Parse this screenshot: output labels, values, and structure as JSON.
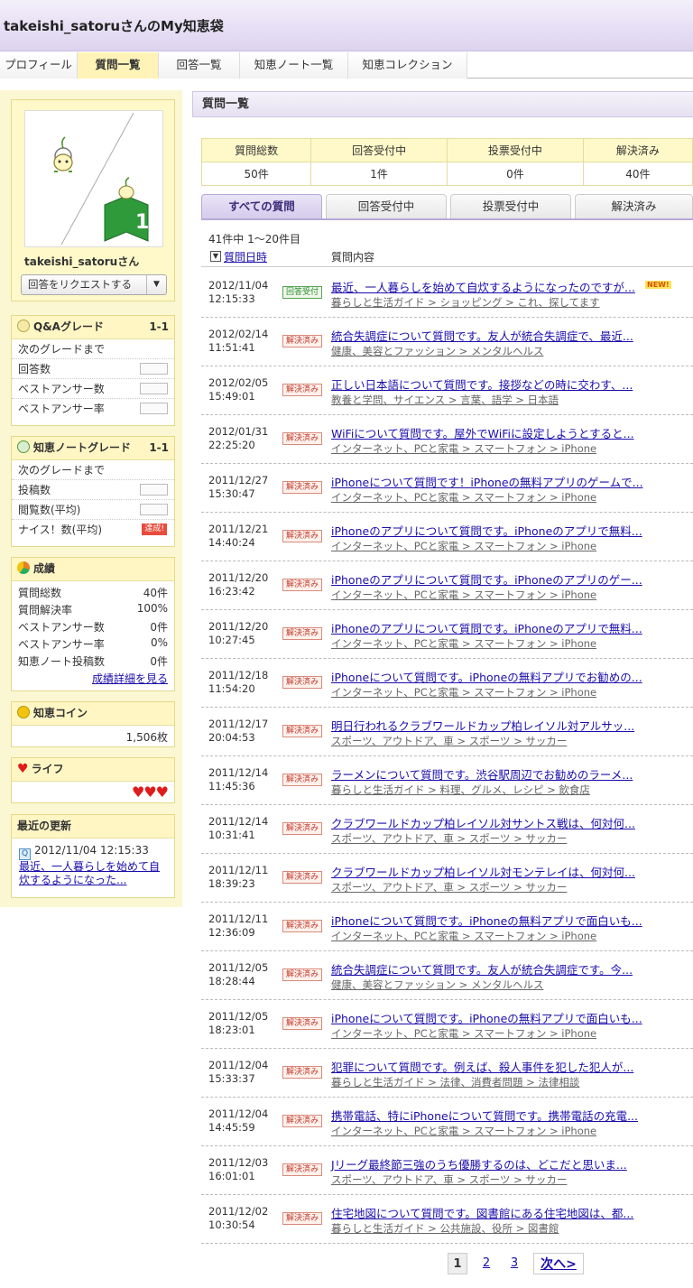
{
  "page_title": "takeishi_satoruさんのMy知恵袋",
  "nav_tabs": [
    {
      "label": "プロフィール"
    },
    {
      "label": "質問一覧"
    },
    {
      "label": "回答一覧"
    },
    {
      "label": "知恵ノート一覧"
    },
    {
      "label": "知恵コレクション"
    }
  ],
  "profile": {
    "username": "takeishi_satoruさん",
    "request_button": "回答をリクエストする",
    "avatar_badge": "1"
  },
  "qa_grade": {
    "title": "Q&Aグレード",
    "grade": "1-1",
    "rows": [
      "次のグレードまで",
      "回答数",
      "ベストアンサー数",
      "ベストアンサー率"
    ]
  },
  "note_grade": {
    "title": "知恵ノートグレード",
    "grade": "1-1",
    "rows": [
      "次のグレードまで",
      "投稿数",
      "閲覧数(平均)",
      "ナイス！数(平均)"
    ],
    "badge": "達成!"
  },
  "results": {
    "title": "成績",
    "rows": [
      {
        "label": "質問総数",
        "value": "40件"
      },
      {
        "label": "質問解決率",
        "value": "100%"
      },
      {
        "label": "ベストアンサー数",
        "value": "0件"
      },
      {
        "label": "ベストアンサー率",
        "value": "0%"
      },
      {
        "label": "知恵ノート投稿数",
        "value": "0件"
      }
    ],
    "detail_link": "成績詳細を見る"
  },
  "coins": {
    "title": "知恵コイン",
    "value": "1,506枚"
  },
  "life": {
    "title": "ライフ",
    "hearts": "♥♥♥"
  },
  "recent": {
    "title": "最近の更新",
    "date": "2012/11/04 12:15:33",
    "link": "最近、一人暮らしを始めて自炊するようになった..."
  },
  "main": {
    "heading": "質問一覧"
  },
  "stats": {
    "headers": [
      "質問総数",
      "回答受付中",
      "投票受付中",
      "解決済み"
    ],
    "values": [
      "50件",
      "1件",
      "0件",
      "40件"
    ]
  },
  "filter_tabs": [
    "すべての質問",
    "回答受付中",
    "投票受付中",
    "解決済み"
  ],
  "count_text": "41件中 1〜20件目",
  "col_headers": {
    "sort_icon": "▼",
    "date": "質問日時",
    "content": "質問内容"
  },
  "questions": [
    {
      "date": "2012/11/04",
      "time": "12:15:33",
      "status": "回答受付",
      "title": "最近、一人暮らしを始めて自炊するようになったのですが...",
      "cat": "暮らしと生活ガイド > ショッピング > これ、探してます",
      "new": "NEW!"
    },
    {
      "date": "2012/02/14",
      "time": "11:51:41",
      "status": "解決済み",
      "title": "統合失調症について質問です。友人が統合失調症で、最近...",
      "cat": "健康、美容とファッション > メンタルヘルス"
    },
    {
      "date": "2012/02/05",
      "time": "15:49:01",
      "status": "解決済み",
      "title": "正しい日本語について質問です。接拶などの時に交わす、...",
      "cat": "教養と学問、サイエンス > 言葉、語学 > 日本語"
    },
    {
      "date": "2012/01/31",
      "time": "22:25:20",
      "status": "解決済み",
      "title": "WiFiについて質問です。屋外でWiFiに設定しようとすると...",
      "cat": "インターネット、PCと家電 > スマートフォン > iPhone"
    },
    {
      "date": "2011/12/27",
      "time": "15:30:47",
      "status": "解決済み",
      "title": "iPhoneについて質問です！iPhoneの無料アプリのゲームで...",
      "cat": "インターネット、PCと家電 > スマートフォン > iPhone"
    },
    {
      "date": "2011/12/21",
      "time": "14:40:24",
      "status": "解決済み",
      "title": "iPhoneのアプリについて質問です。iPhoneのアプリで無料...",
      "cat": "インターネット、PCと家電 > スマートフォン > iPhone"
    },
    {
      "date": "2011/12/20",
      "time": "16:23:42",
      "status": "解決済み",
      "title": "iPhoneのアプリについて質問です。iPhoneのアプリのゲー...",
      "cat": "インターネット、PCと家電 > スマートフォン > iPhone"
    },
    {
      "date": "2011/12/20",
      "time": "10:27:45",
      "status": "解決済み",
      "title": "iPhoneのアプリについて質問です。iPhoneのアプリで無料...",
      "cat": "インターネット、PCと家電 > スマートフォン > iPhone"
    },
    {
      "date": "2011/12/18",
      "time": "11:54:20",
      "status": "解決済み",
      "title": "iPhoneについて質問です。iPhoneの無料アプリでお勧めの...",
      "cat": "インターネット、PCと家電 > スマートフォン > iPhone"
    },
    {
      "date": "2011/12/17",
      "time": "20:04:53",
      "status": "解決済み",
      "title": "明日行われるクラブワールドカップ柏レイソル対アルサッ...",
      "cat": "スポーツ、アウトドア、車 > スポーツ > サッカー"
    },
    {
      "date": "2011/12/14",
      "time": "11:45:36",
      "status": "解決済み",
      "title": "ラーメンについて質問です。渋谷駅周辺でお勧めのラーメ...",
      "cat": "暮らしと生活ガイド > 料理、グルメ、レシピ > 飲食店"
    },
    {
      "date": "2011/12/14",
      "time": "10:31:41",
      "status": "解決済み",
      "title": "クラブワールドカップ柏レイソル対サントス戦は、何対何...",
      "cat": "スポーツ、アウトドア、車 > スポーツ > サッカー"
    },
    {
      "date": "2011/12/11",
      "time": "18:39:23",
      "status": "解決済み",
      "title": "クラブワールドカップ柏レイソル対モンテレイは、何対何...",
      "cat": "スポーツ、アウトドア、車 > スポーツ > サッカー"
    },
    {
      "date": "2011/12/11",
      "time": "12:36:09",
      "status": "解決済み",
      "title": "iPhoneについて質問です。iPhoneの無料アプリで面白いも...",
      "cat": "インターネット、PCと家電 > スマートフォン > iPhone"
    },
    {
      "date": "2011/12/05",
      "time": "18:28:44",
      "status": "解決済み",
      "title": "統合失調症について質問です。友人が統合失調症です。今...",
      "cat": "健康、美容とファッション > メンタルヘルス"
    },
    {
      "date": "2011/12/05",
      "time": "18:23:01",
      "status": "解決済み",
      "title": "iPhoneについて質問です。iPhoneの無料アプリで面白いも...",
      "cat": "インターネット、PCと家電 > スマートフォン > iPhone"
    },
    {
      "date": "2011/12/04",
      "time": "15:33:37",
      "status": "解決済み",
      "title": "犯罪について質問です。例えば、殺人事件を犯した犯人が...",
      "cat": "暮らしと生活ガイド > 法律、消費者問題 > 法律相談"
    },
    {
      "date": "2011/12/04",
      "time": "14:45:59",
      "status": "解決済み",
      "title": "携帯電話、特にiPhoneについて質問です。携帯電話の充電...",
      "cat": "インターネット、PCと家電 > スマートフォン > iPhone"
    },
    {
      "date": "2011/12/03",
      "time": "16:01:01",
      "status": "解決済み",
      "title": "Jリーグ最終節三強のうち優勝するのは、どこだと思いま...",
      "cat": "スポーツ、アウトドア、車 > スポーツ > サッカー"
    },
    {
      "date": "2011/12/02",
      "time": "10:30:54",
      "status": "解決済み",
      "title": "住宅地図について質問です。図書館にある住宅地図は、都...",
      "cat": "暮らしと生活ガイド > 公共施設、役所 > 図書館"
    }
  ],
  "pager": {
    "pages": [
      "1",
      "2",
      "3"
    ],
    "next": "次へ>"
  }
}
